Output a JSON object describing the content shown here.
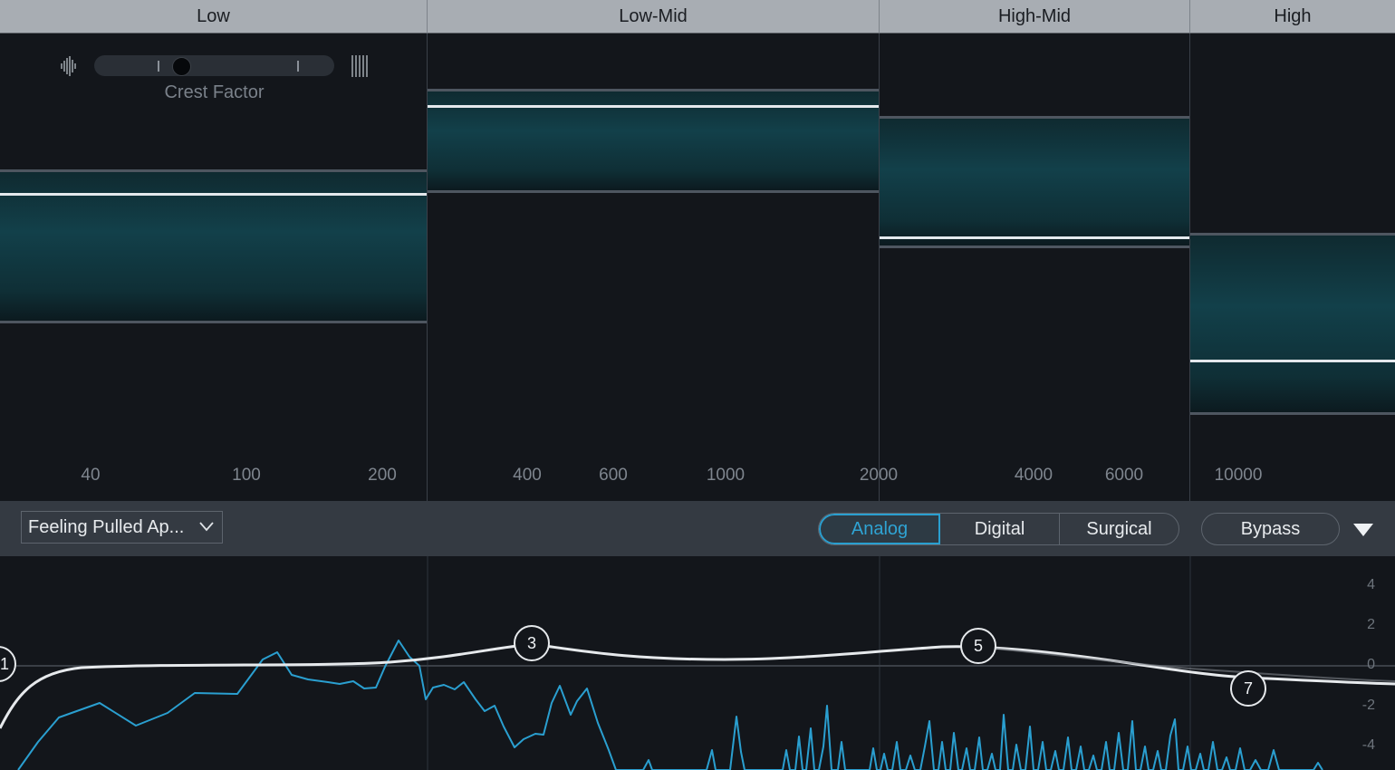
{
  "bands": [
    {
      "name": "Low"
    },
    {
      "name": "Low-Mid"
    },
    {
      "name": "High-Mid"
    },
    {
      "name": "High"
    }
  ],
  "crest_factor": {
    "label": "Crest Factor",
    "value": 0.35,
    "left_icon": "waveform-dense-icon",
    "right_icon": "waveform-sparse-icon"
  },
  "freq_axis": [
    "40",
    "100",
    "200",
    "400",
    "600",
    "1000",
    "2000",
    "4000",
    "6000",
    "10000"
  ],
  "toolbar": {
    "preset": "Feeling Pulled Ap...",
    "modes": [
      "Analog",
      "Digital",
      "Surgical"
    ],
    "active_mode": "Analog",
    "bypass_label": "Bypass",
    "menu_icon": "triangle-down-icon"
  },
  "eq": {
    "db_axis": [
      "4",
      "2",
      "0",
      "-2",
      "-4"
    ],
    "nodes": [
      "1",
      "3",
      "5",
      "7"
    ]
  },
  "colors": {
    "accent": "#2fa4d4",
    "band_fill": "#12404a",
    "header_bg": "#a8adb3",
    "spectrum": "#2a9fd0",
    "curve": "#e4e8ec"
  }
}
